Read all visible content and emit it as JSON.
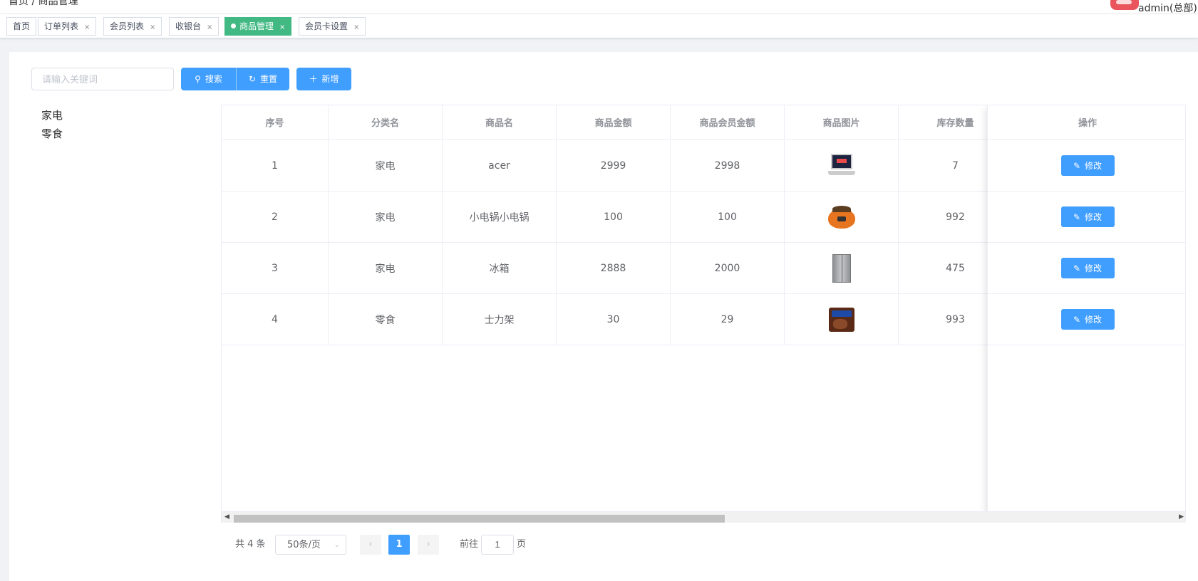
{
  "header": {
    "breadcrumb": "首页 / 商品管理",
    "user": "admin(总部)"
  },
  "tags": [
    {
      "label": "首页",
      "closable": false,
      "active": false
    },
    {
      "label": "订单列表",
      "closable": true,
      "active": false
    },
    {
      "label": "会员列表",
      "closable": true,
      "active": false
    },
    {
      "label": "收银台",
      "closable": true,
      "active": false
    },
    {
      "label": "商品管理",
      "closable": true,
      "active": true
    },
    {
      "label": "会员卡设置",
      "closable": true,
      "active": false
    }
  ],
  "close_glyph": "×",
  "toolbar": {
    "search_placeholder": "请输入关键词",
    "search_label": "搜索",
    "reset_label": "重置",
    "add_label": "新增"
  },
  "categories": [
    "家电",
    "零食"
  ],
  "table": {
    "columns": [
      "序号",
      "分类名",
      "商品名",
      "商品金额",
      "商品会员金额",
      "商品图片",
      "库存数量",
      ""
    ],
    "op_column": "操作",
    "op_label": "修改",
    "rows": [
      {
        "index": "1",
        "category": "家电",
        "name": "acer",
        "price": "2999",
        "member_price": "2998",
        "image": "laptop",
        "stock": "7"
      },
      {
        "index": "2",
        "category": "家电",
        "name": "小电锅小电锅",
        "price": "100",
        "member_price": "100",
        "image": "rice-cooker",
        "stock": "992"
      },
      {
        "index": "3",
        "category": "家电",
        "name": "冰箱",
        "price": "2888",
        "member_price": "2000",
        "image": "fridge",
        "stock": "475"
      },
      {
        "index": "4",
        "category": "零食",
        "name": "士力架",
        "price": "30",
        "member_price": "29",
        "image": "snickers",
        "stock": "993"
      }
    ]
  },
  "pagination": {
    "total": "共 4 条",
    "page_size": "50条/页",
    "current_page": "1",
    "goto_label": "前往",
    "goto_value": "1",
    "page_unit": "页"
  },
  "colors": {
    "primary": "#409eff",
    "active_tag": "#42b983"
  }
}
